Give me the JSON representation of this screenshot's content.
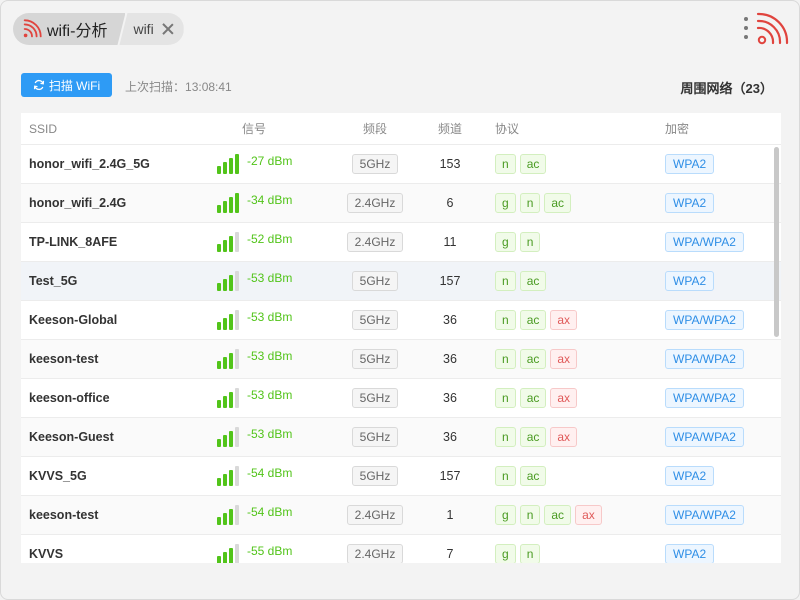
{
  "window": {
    "tab_main_label": "wifi-分析",
    "tab_sub_label": "wifi"
  },
  "toolbar": {
    "scan_label": "扫描 WiFi",
    "last_scan_label": "上次扫描：",
    "last_scan_time": "13:08:41",
    "nearby_label": "周围网络（23）"
  },
  "table": {
    "headers": {
      "ssid": "SSID",
      "signal": "信号",
      "band": "频段",
      "channel": "频道",
      "protocol": "协议",
      "encryption": "加密"
    },
    "rows": [
      {
        "ssid": "honor_wifi_2.4G_5G",
        "dbm": "-27 dBm",
        "bars": 4,
        "band": "5GHz",
        "channel": "153",
        "protocols": [
          "n",
          "ac"
        ],
        "encryption": "WPA2"
      },
      {
        "ssid": "honor_wifi_2.4G",
        "dbm": "-34 dBm",
        "bars": 4,
        "band": "2.4GHz",
        "channel": "6",
        "protocols": [
          "g",
          "n",
          "ac"
        ],
        "encryption": "WPA2"
      },
      {
        "ssid": "TP-LINK_8AFE",
        "dbm": "-52 dBm",
        "bars": 3,
        "band": "2.4GHz",
        "channel": "11",
        "protocols": [
          "g",
          "n"
        ],
        "encryption": "WPA/WPA2"
      },
      {
        "ssid": "Test_5G",
        "dbm": "-53 dBm",
        "bars": 3,
        "band": "5GHz",
        "channel": "157",
        "protocols": [
          "n",
          "ac"
        ],
        "encryption": "WPA2"
      },
      {
        "ssid": "Keeson-Global",
        "dbm": "-53 dBm",
        "bars": 3,
        "band": "5GHz",
        "channel": "36",
        "protocols": [
          "n",
          "ac",
          "ax"
        ],
        "encryption": "WPA/WPA2"
      },
      {
        "ssid": "keeson-test",
        "dbm": "-53 dBm",
        "bars": 3,
        "band": "5GHz",
        "channel": "36",
        "protocols": [
          "n",
          "ac",
          "ax"
        ],
        "encryption": "WPA/WPA2"
      },
      {
        "ssid": "keeson-office",
        "dbm": "-53 dBm",
        "bars": 3,
        "band": "5GHz",
        "channel": "36",
        "protocols": [
          "n",
          "ac",
          "ax"
        ],
        "encryption": "WPA/WPA2"
      },
      {
        "ssid": "Keeson-Guest",
        "dbm": "-53 dBm",
        "bars": 3,
        "band": "5GHz",
        "channel": "36",
        "protocols": [
          "n",
          "ac",
          "ax"
        ],
        "encryption": "WPA/WPA2"
      },
      {
        "ssid": "KVVS_5G",
        "dbm": "-54 dBm",
        "bars": 3,
        "band": "5GHz",
        "channel": "157",
        "protocols": [
          "n",
          "ac"
        ],
        "encryption": "WPA2"
      },
      {
        "ssid": "keeson-test",
        "dbm": "-54 dBm",
        "bars": 3,
        "band": "2.4GHz",
        "channel": "1",
        "protocols": [
          "g",
          "n",
          "ac",
          "ax"
        ],
        "encryption": "WPA/WPA2"
      },
      {
        "ssid": "KVVS",
        "dbm": "-55 dBm",
        "bars": 3,
        "band": "2.4GHz",
        "channel": "7",
        "protocols": [
          "g",
          "n"
        ],
        "encryption": "WPA2"
      }
    ]
  },
  "colors": {
    "accent": "#2e9bf5",
    "signal_green": "#52c41a",
    "logo_red": "#e0443e"
  }
}
